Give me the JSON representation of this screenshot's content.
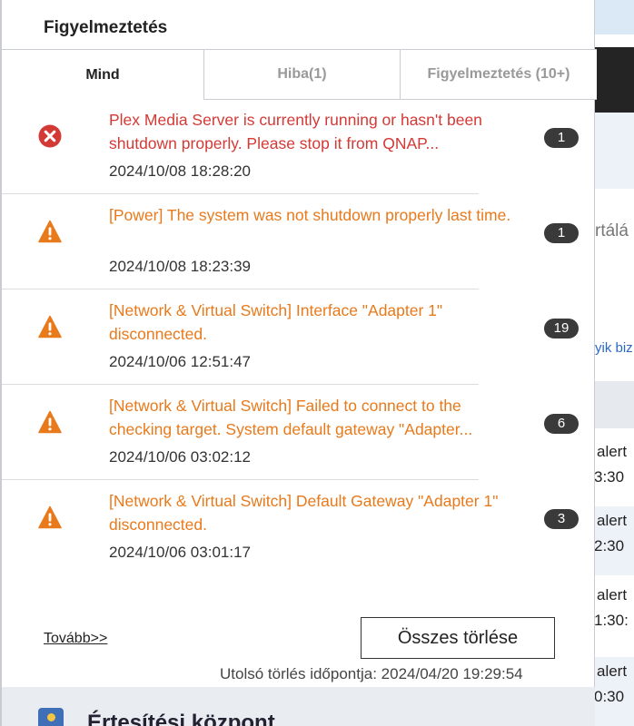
{
  "panel": {
    "title": "Figyelmeztetés"
  },
  "tabs": [
    {
      "label": "Mind"
    },
    {
      "label": "Hiba(1)"
    },
    {
      "label": "Figyelmeztetés (10+)"
    }
  ],
  "notifications": [
    {
      "type": "error",
      "icon": "error-x-icon",
      "message": "Plex Media Server is currently running or hasn't been shutdown properly. Please stop it from QNAP...",
      "timestamp": "2024/10/08 18:28:20",
      "count": "1"
    },
    {
      "type": "warning",
      "icon": "warning-triangle-icon",
      "message": "[Power] The system was not shutdown properly last time.",
      "timestamp": "2024/10/08 18:23:39",
      "count": "1"
    },
    {
      "type": "warning",
      "icon": "warning-triangle-icon",
      "message": "[Network & Virtual Switch] Interface \"Adapter 1\" disconnected.",
      "timestamp": "2024/10/06 12:51:47",
      "count": "19"
    },
    {
      "type": "warning",
      "icon": "warning-triangle-icon",
      "message": "[Network & Virtual Switch] Failed to connect to the checking target. System default gateway \"Adapter...",
      "timestamp": "2024/10/06 03:02:12",
      "count": "6"
    },
    {
      "type": "warning",
      "icon": "warning-triangle-icon",
      "message": "[Network & Virtual Switch] Default Gateway \"Adapter 1\" disconnected.",
      "timestamp": "2024/10/06 03:01:17",
      "count": "3"
    }
  ],
  "actions": {
    "more_label": "Tovább>>",
    "clear_all_label": "Összes törlése",
    "last_clear": "Utolsó törlés időpontja: 2024/04/20 19:29:54"
  },
  "footer": {
    "icon": "notification-center-icon",
    "title": "Értesítési központ"
  },
  "background": {
    "fragments": [
      "rtálá",
      "yik biz"
    ],
    "rows": [
      {
        "l1": "alert",
        "l2": "3:30"
      },
      {
        "l1": "alert",
        "l2": "2:30"
      },
      {
        "l1": "alert",
        "l2": "1:30:"
      },
      {
        "l1": "alert",
        "l2": "0:30"
      }
    ]
  },
  "colors": {
    "error": "#d33a36",
    "warning": "#e87a1c",
    "badge": "#3a3a3a"
  }
}
